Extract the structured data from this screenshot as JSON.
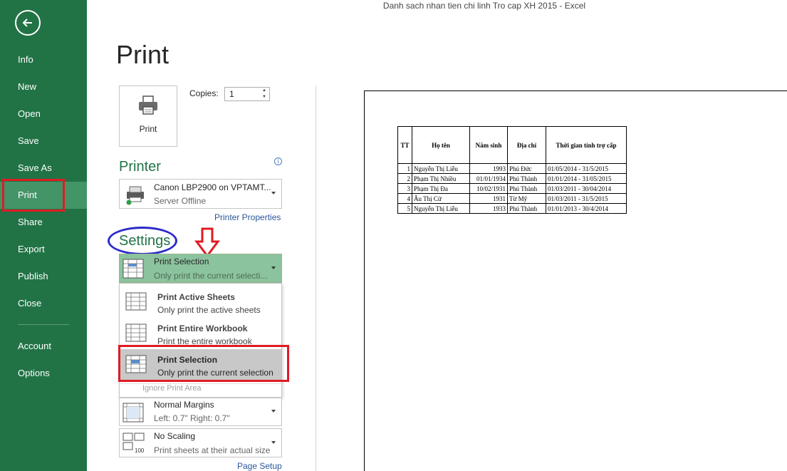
{
  "window_title": "Danh sach nhan tien chi linh Tro cap XH 2015 - Excel",
  "sidebar": {
    "items": [
      {
        "label": "Info"
      },
      {
        "label": "New"
      },
      {
        "label": "Open"
      },
      {
        "label": "Save"
      },
      {
        "label": "Save As"
      },
      {
        "label": "Print"
      },
      {
        "label": "Share"
      },
      {
        "label": "Export"
      },
      {
        "label": "Publish"
      },
      {
        "label": "Close"
      },
      {
        "label": "Account"
      },
      {
        "label": "Options"
      }
    ],
    "active": "Print"
  },
  "main": {
    "title": "Print",
    "print_button_label": "Print",
    "copies_label": "Copies:",
    "copies_value": "1",
    "printer_heading": "Printer",
    "printer_name": "Canon LBP2900 on VPTAMT...",
    "printer_status": "Server Offline",
    "printer_properties_link": "Printer Properties",
    "settings_heading": "Settings",
    "settings_selected_title": "Print Selection",
    "settings_selected_desc": "Only print the current selecti...",
    "menu": {
      "items": [
        {
          "title": "Print Active Sheets",
          "desc": "Only print the active sheets"
        },
        {
          "title": "Print Entire Workbook",
          "desc": "Print the entire workbook"
        },
        {
          "title": "Print Selection",
          "desc": "Only print the current selection"
        }
      ],
      "ignore_label": "Ignore Print Area"
    },
    "margins_title": "Normal Margins",
    "margins_desc": "Left:  0.7\"    Right:  0.7\"",
    "scaling_title": "No Scaling",
    "scaling_desc": "Print sheets at their actual size",
    "scaling_icon_text": "100",
    "page_setup_link": "Page Setup"
  },
  "preview_table": {
    "headers": [
      "TT",
      "Họ tên",
      "Năm sinh",
      "Địa chỉ",
      "Thời gian tính trợ cấp"
    ],
    "rows": [
      [
        "1",
        "Nguyễn Thị Liễu",
        "1993",
        "Phú Đức",
        "01/05/2014 - 31/5/2015"
      ],
      [
        "2",
        "Phạm Thị Nhiều",
        "01/01/1934",
        "Phú Thành",
        "01/01/2014 - 31/05/2015"
      ],
      [
        "3",
        "Phạm Thị Đa",
        "10/02/1931",
        "Phú Thành",
        "01/03/2011 - 30/04/2014"
      ],
      [
        "4",
        "Âu Thị Cử",
        "1931",
        "Từ Mỹ",
        "01/03/2011 - 31/5/2015"
      ],
      [
        "5",
        "Nguyễn Thị Liễu",
        "1933",
        "Phú Thành",
        "01/01/2013 - 30/4/2014"
      ]
    ]
  },
  "colors": {
    "sidebar_bg": "#217346",
    "sidebar_active": "#439467",
    "accent_green": "#217346",
    "highlight_red": "#e01b24",
    "annotation_blue": "#2b2bc8"
  },
  "icons": [
    "back-arrow-icon",
    "printer-icon",
    "printer-device-icon",
    "sheet-grid-icon",
    "margins-icon",
    "scaling-icon",
    "info-icon"
  ]
}
